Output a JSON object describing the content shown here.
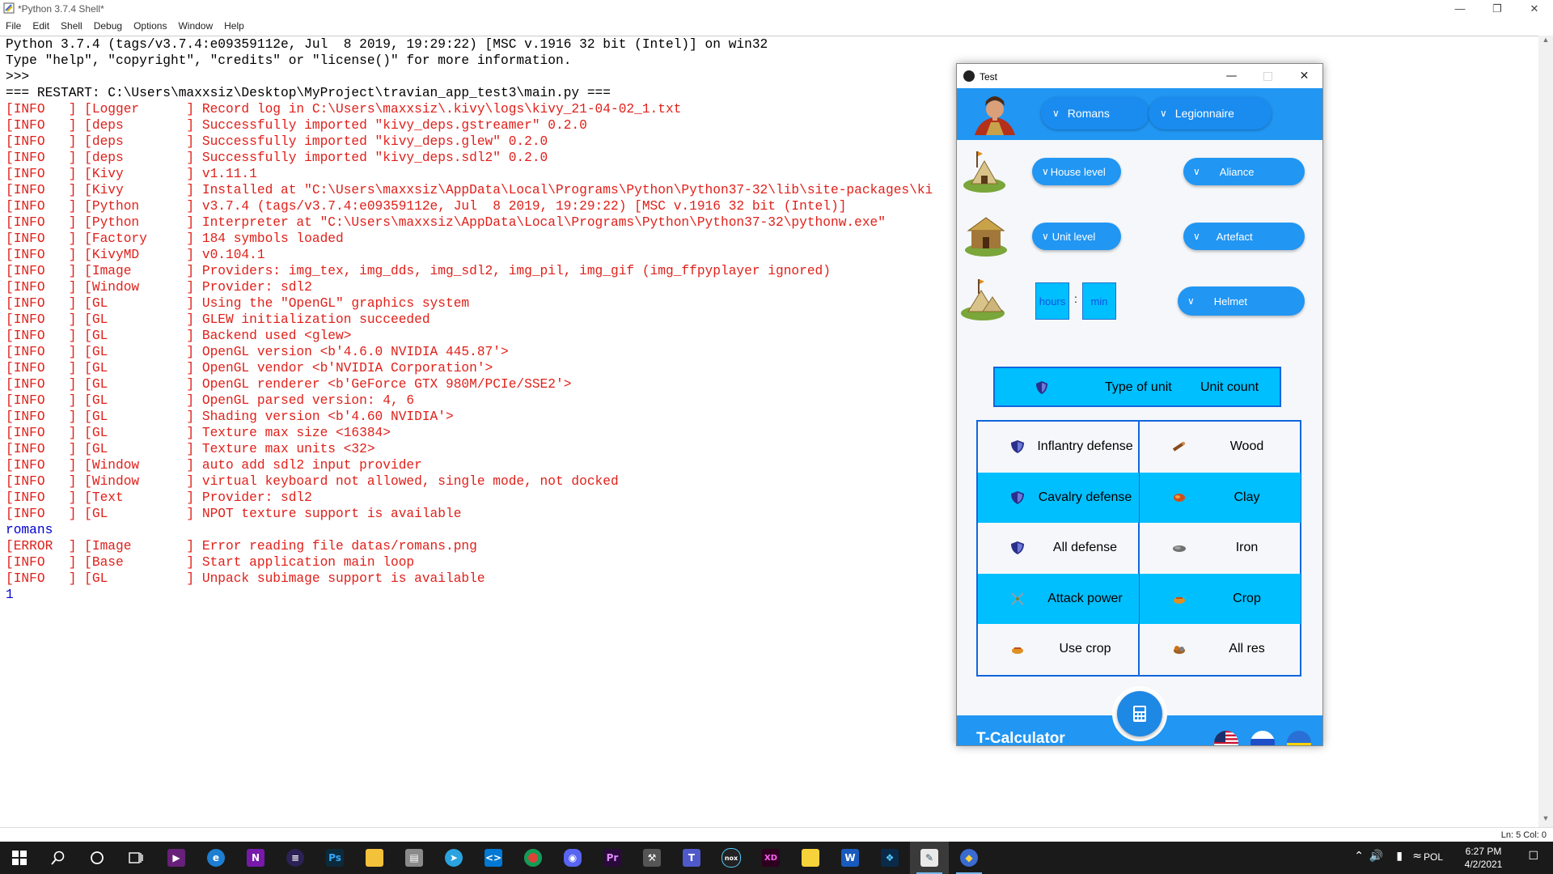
{
  "idle": {
    "title": "*Python 3.7.4 Shell*",
    "menu": [
      "File",
      "Edit",
      "Shell",
      "Debug",
      "Options",
      "Window",
      "Help"
    ],
    "status": "Ln: 5   Col: 0",
    "lines": [
      {
        "t": "Python 3.7.4 (tags/v3.7.4:e09359112e, Jul  8 2019, 19:29:22) [MSC v.1916 32 bit (Intel)] on win32",
        "c": "black"
      },
      {
        "t": "Type \"help\", \"copyright\", \"credits\" or \"license()\" for more information.",
        "c": "black"
      },
      {
        "t": ">>> ",
        "c": "black"
      },
      {
        "t": "=== RESTART: C:\\Users\\maxxsiz\\Desktop\\MyProject\\travian_app_test3\\main.py ===",
        "c": "black"
      },
      {
        "t": "[INFO   ] [Logger      ] Record log in C:\\Users\\maxxsiz\\.kivy\\logs\\kivy_21-04-02_1.txt",
        "c": "red"
      },
      {
        "t": "[INFO   ] [deps        ] Successfully imported \"kivy_deps.gstreamer\" 0.2.0",
        "c": "red"
      },
      {
        "t": "[INFO   ] [deps        ] Successfully imported \"kivy_deps.glew\" 0.2.0",
        "c": "red"
      },
      {
        "t": "[INFO   ] [deps        ] Successfully imported \"kivy_deps.sdl2\" 0.2.0",
        "c": "red"
      },
      {
        "t": "[INFO   ] [Kivy        ] v1.11.1",
        "c": "red"
      },
      {
        "t": "[INFO   ] [Kivy        ] Installed at \"C:\\Users\\maxxsiz\\AppData\\Local\\Programs\\Python\\Python37-32\\lib\\site-packages\\ki",
        "c": "red"
      },
      {
        "t": "[INFO   ] [Python      ] v3.7.4 (tags/v3.7.4:e09359112e, Jul  8 2019, 19:29:22) [MSC v.1916 32 bit (Intel)]",
        "c": "red"
      },
      {
        "t": "[INFO   ] [Python      ] Interpreter at \"C:\\Users\\maxxsiz\\AppData\\Local\\Programs\\Python\\Python37-32\\pythonw.exe\"",
        "c": "red"
      },
      {
        "t": "[INFO   ] [Factory     ] 184 symbols loaded",
        "c": "red"
      },
      {
        "t": "[INFO   ] [KivyMD      ] v0.104.1",
        "c": "red"
      },
      {
        "t": "[INFO   ] [Image       ] Providers: img_tex, img_dds, img_sdl2, img_pil, img_gif (img_ffpyplayer ignored)",
        "c": "red"
      },
      {
        "t": "[INFO   ] [Window      ] Provider: sdl2",
        "c": "red"
      },
      {
        "t": "[INFO   ] [GL          ] Using the \"OpenGL\" graphics system",
        "c": "red"
      },
      {
        "t": "[INFO   ] [GL          ] GLEW initialization succeeded",
        "c": "red"
      },
      {
        "t": "[INFO   ] [GL          ] Backend used <glew>",
        "c": "red"
      },
      {
        "t": "[INFO   ] [GL          ] OpenGL version <b'4.6.0 NVIDIA 445.87'>",
        "c": "red"
      },
      {
        "t": "[INFO   ] [GL          ] OpenGL vendor <b'NVIDIA Corporation'>",
        "c": "red"
      },
      {
        "t": "[INFO   ] [GL          ] OpenGL renderer <b'GeForce GTX 980M/PCIe/SSE2'>",
        "c": "red"
      },
      {
        "t": "[INFO   ] [GL          ] OpenGL parsed version: 4, 6",
        "c": "red"
      },
      {
        "t": "[INFO   ] [GL          ] Shading version <b'4.60 NVIDIA'>",
        "c": "red"
      },
      {
        "t": "[INFO   ] [GL          ] Texture max size <16384>",
        "c": "red"
      },
      {
        "t": "[INFO   ] [GL          ] Texture max units <32>",
        "c": "red"
      },
      {
        "t": "[INFO   ] [Window      ] auto add sdl2 input provider",
        "c": "red"
      },
      {
        "t": "[INFO   ] [Window      ] virtual keyboard not allowed, single mode, not docked",
        "c": "red"
      },
      {
        "t": "[INFO   ] [Text        ] Provider: sdl2",
        "c": "red"
      },
      {
        "t": "[INFO   ] [GL          ] NPOT texture support is available",
        "c": "red"
      },
      {
        "t": "romans",
        "c": "blue"
      },
      {
        "t": "[ERROR  ] [Image       ] Error reading file datas/romans.png",
        "c": "red"
      },
      {
        "t": "[INFO   ] [Base        ] Start application main loop",
        "c": "red"
      },
      {
        "t": "[INFO   ] [GL          ] Unpack subimage support is available",
        "c": "red"
      },
      {
        "t": "1",
        "c": "blue"
      }
    ]
  },
  "app": {
    "window_title": "Test",
    "tribe": "Romans",
    "unit": "Legionnaire",
    "house_level": "House level",
    "aliance": "Aliance",
    "unit_level": "Unit level",
    "artefact": "Artefact",
    "hours": "hours",
    "colon": ":",
    "min": "min",
    "helmet": "Helmet",
    "header_type": "Type of unit",
    "header_count": "Unit count",
    "left_cells": [
      {
        "label": "Inflantry defense",
        "icon": "shield-icon"
      },
      {
        "label": "Cavalry defense",
        "icon": "shield-icon"
      },
      {
        "label": "All defense",
        "icon": "shield-icon"
      },
      {
        "label": "Attack power",
        "icon": "crossed-swords-icon"
      },
      {
        "label": "Use crop",
        "icon": "crop-icon"
      }
    ],
    "right_cells": [
      {
        "label": "Wood",
        "icon": "wood-icon"
      },
      {
        "label": "Clay",
        "icon": "clay-icon"
      },
      {
        "label": "Iron",
        "icon": "iron-icon"
      },
      {
        "label": "Crop",
        "icon": "crop-icon"
      },
      {
        "label": "All res",
        "icon": "all-resources-icon"
      }
    ],
    "app_name": "T-Calculator",
    "fab_icon": "calculator-icon"
  },
  "tray": {
    "lang": "POL",
    "time": "6:27 PM",
    "date": "4/2/2021"
  },
  "colors": {
    "accent": "#2196f3",
    "cell_blue": "#00bfff",
    "border": "#1166dd",
    "log_red": "#e0201a"
  }
}
